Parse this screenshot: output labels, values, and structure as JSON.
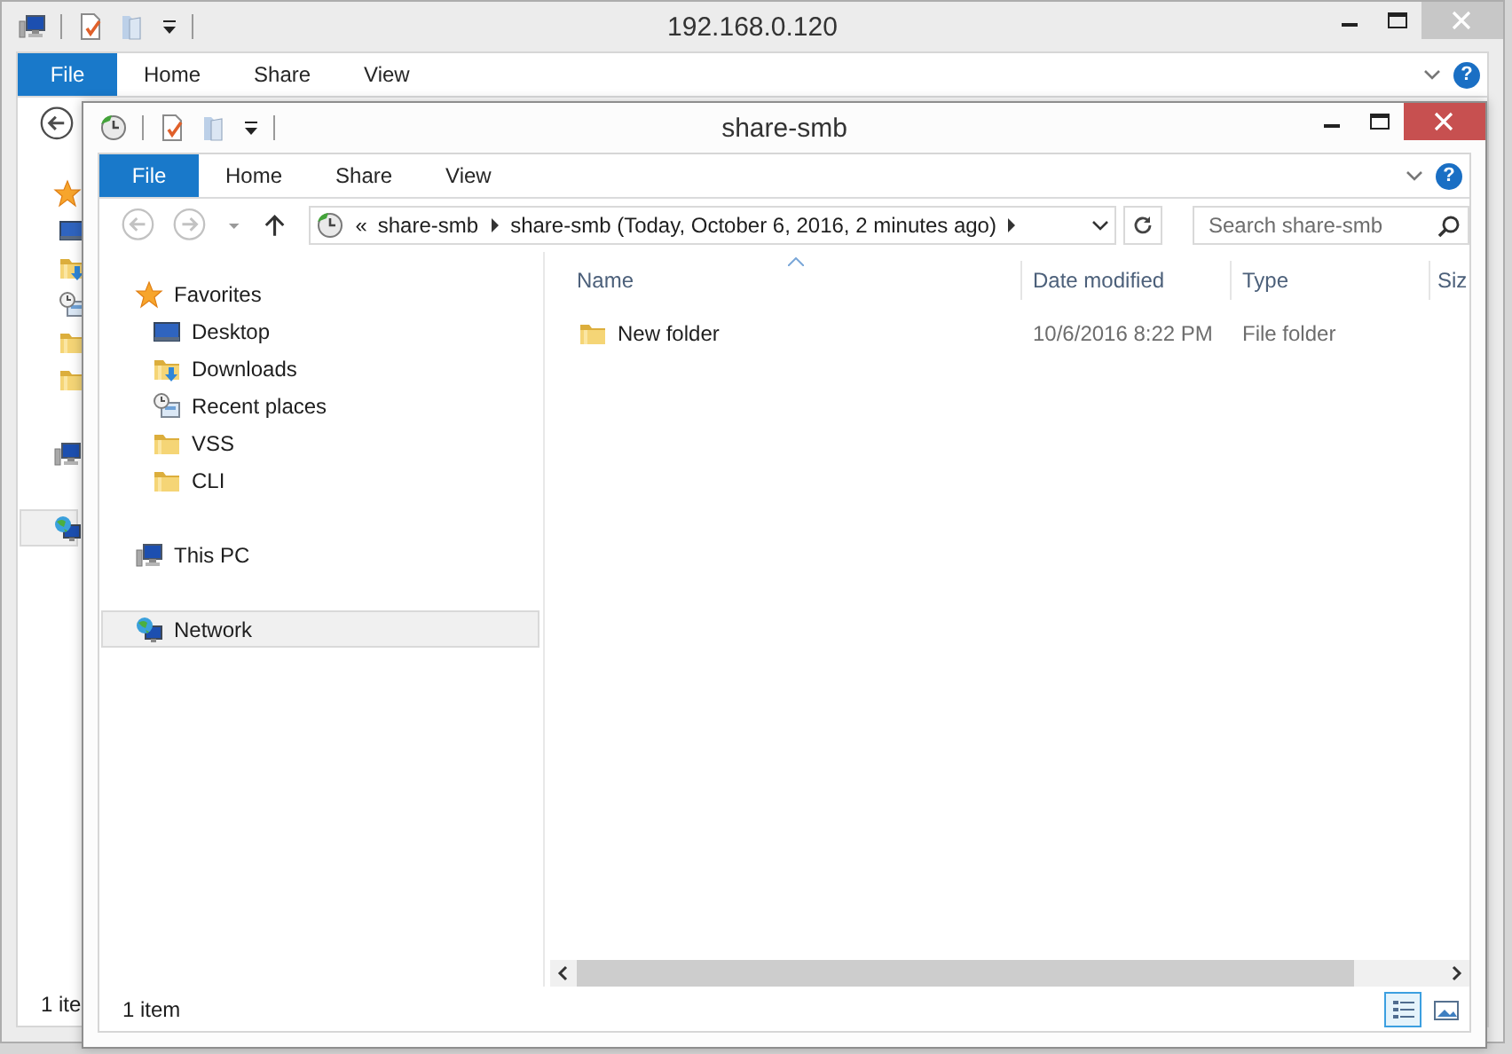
{
  "back_window": {
    "active": false,
    "title": "192.168.0.120",
    "help": "?",
    "tabs": [
      {
        "label": "File",
        "kind": "file"
      },
      {
        "label": "Home",
        "kind": "tab"
      },
      {
        "label": "Share",
        "kind": "tab"
      },
      {
        "label": "View",
        "kind": "tab"
      }
    ],
    "nav_buttons": [
      {
        "kind": "back",
        "disabled": false
      }
    ],
    "nav_pane": [
      {
        "kind": "favorites",
        "selected": false,
        "children": [
          {
            "kind": "desktop",
            "selected": false
          },
          {
            "kind": "downloads",
            "selected": false
          },
          {
            "kind": "recent",
            "selected": false
          },
          {
            "kind": "folder",
            "selected": false
          },
          {
            "kind": "folder",
            "selected": false
          }
        ]
      },
      {
        "kind": "computer",
        "selected": false
      },
      {
        "kind": "network",
        "selected": true
      }
    ],
    "status_bar": "1 ite"
  },
  "front_window": {
    "active": true,
    "title": "share-smb",
    "help": "?",
    "tabs": [
      {
        "label": "File",
        "kind": "file"
      },
      {
        "label": "Home",
        "kind": "tab"
      },
      {
        "label": "Share",
        "kind": "tab"
      },
      {
        "label": "View",
        "kind": "tab"
      }
    ],
    "nav_buttons": [
      {
        "kind": "back",
        "disabled": true
      },
      {
        "kind": "forward",
        "disabled": true
      }
    ],
    "address_bar": {
      "overflow": "«",
      "crumbs": [
        "share-smb",
        "share-smb (Today, October 6, 2016, 2 minutes ago)"
      ]
    },
    "search": {
      "placeholder": "Search share-smb"
    },
    "nav_pane": [
      {
        "label": "Favorites",
        "kind": "favorites",
        "selected": false,
        "children": [
          {
            "label": "Desktop",
            "kind": "desktop",
            "selected": false
          },
          {
            "label": "Downloads",
            "kind": "downloads",
            "selected": false
          },
          {
            "label": "Recent places",
            "kind": "recent",
            "selected": false
          },
          {
            "label": "VSS",
            "kind": "folder",
            "selected": false
          },
          {
            "label": "CLI",
            "kind": "folder",
            "selected": false
          }
        ]
      },
      {
        "label": "This PC",
        "kind": "computer",
        "selected": false
      },
      {
        "label": "Network",
        "kind": "network",
        "selected": true
      }
    ],
    "table": {
      "columns": [
        "Name",
        "Date modified",
        "Type",
        "Siz"
      ],
      "rows": [
        {
          "kind": "folder",
          "cells": [
            "New folder",
            "10/6/2016 8:22 PM",
            "File folder"
          ]
        }
      ]
    },
    "status_bar": "1 item",
    "view_buttons": [
      {
        "kind": "details",
        "selected": true
      },
      {
        "kind": "large_icons",
        "selected": false
      }
    ]
  }
}
